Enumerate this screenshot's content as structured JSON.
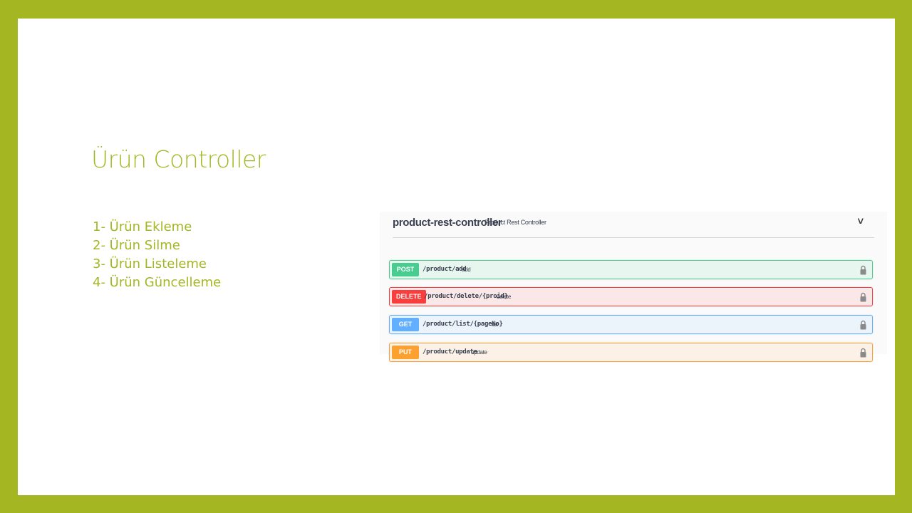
{
  "slide": {
    "title": "Ürün Controller",
    "bullets": [
      "1- Ürün Ekleme",
      "2- Ürün Silme",
      "3- Ürün Listeleme",
      "4- Ürün Güncelleme"
    ]
  },
  "swagger": {
    "controller_name": "product-rest-controller",
    "controller_description": "Product Rest Controller",
    "chevron_icon": "chevron-down-icon",
    "operations": [
      {
        "method": "POST",
        "path": "/product/add",
        "summary": "add",
        "color": "#49cc90"
      },
      {
        "method": "DELETE",
        "path": "/product/delete/{proid}",
        "summary": "delete",
        "color": "#f93e3e"
      },
      {
        "method": "GET",
        "path": "/product/list/{pageNo}",
        "summary": "list",
        "color": "#61affe"
      },
      {
        "method": "PUT",
        "path": "/product/update",
        "summary": "update",
        "color": "#fca130"
      }
    ]
  },
  "colors": {
    "accent": "#a4b723",
    "slide_background": "#ffffff",
    "text_dark": "#3b4151"
  }
}
